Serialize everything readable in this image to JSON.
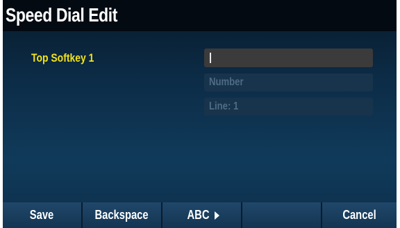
{
  "header": {
    "title": "Speed Dial Edit"
  },
  "form": {
    "label": "Top Softkey 1",
    "name_value": "",
    "number_placeholder": "Number",
    "line_value": "Line: 1"
  },
  "softkeys": {
    "save": "Save",
    "backspace": "Backspace",
    "abc": "ABC",
    "empty": "",
    "cancel": "Cancel"
  },
  "colors": {
    "title_bar": "#040a12",
    "label": "#f2e31c",
    "softkey_bar": "#1b4062"
  }
}
